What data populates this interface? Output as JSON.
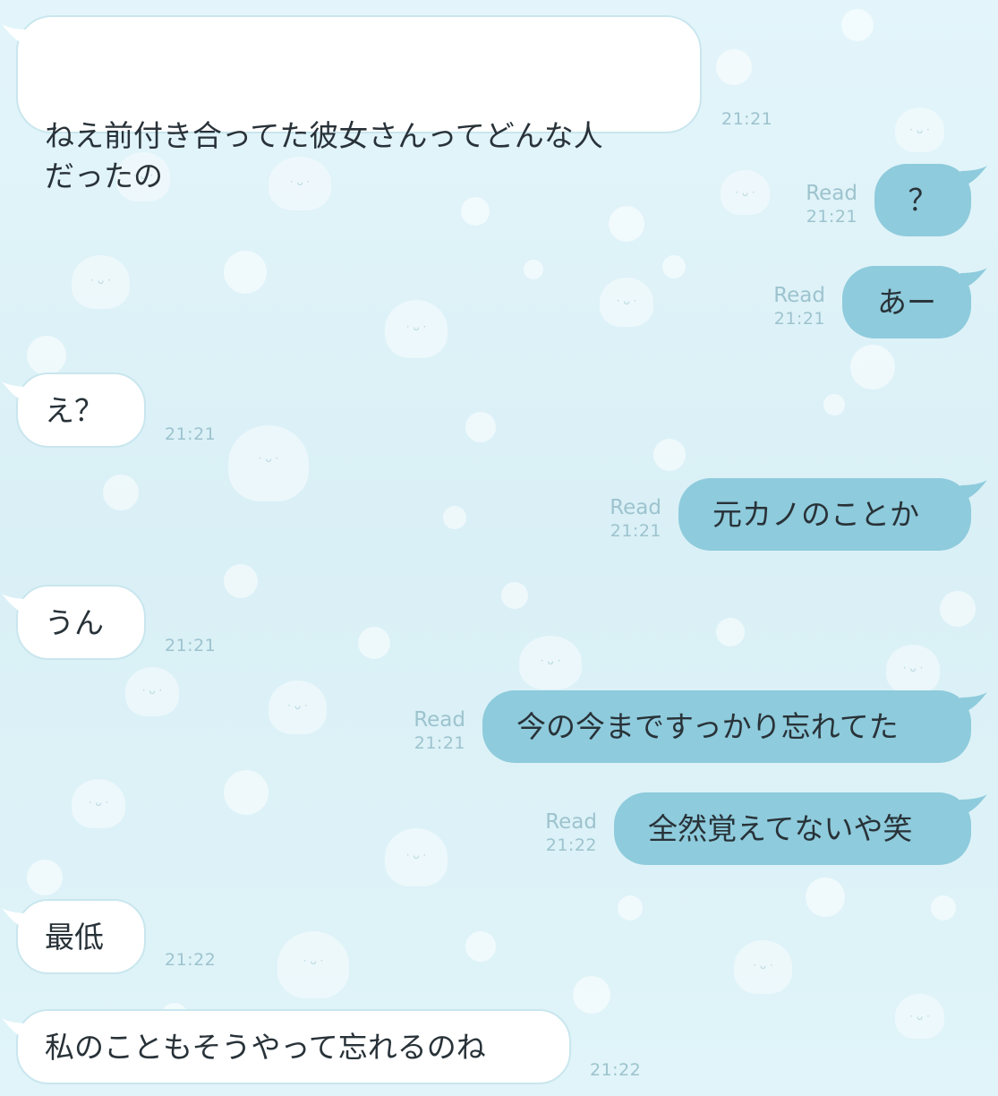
{
  "read_label": "Read",
  "messages": [
    {
      "side": "in",
      "text": "ねえ前付き合ってた彼女さんってどんな人\nだったの",
      "time": "21:21"
    },
    {
      "side": "out",
      "text": "？",
      "time": "21:21"
    },
    {
      "side": "out",
      "text": "あー",
      "time": "21:21"
    },
    {
      "side": "in",
      "text": "え？",
      "time": "21:21"
    },
    {
      "side": "out",
      "text": "元カノのことか",
      "time": "21:21"
    },
    {
      "side": "in",
      "text": "うん",
      "time": "21:21"
    },
    {
      "side": "out",
      "text": "今の今まですっかり忘れてた",
      "time": "21:21"
    },
    {
      "side": "out",
      "text": "全然覚えてないや笑",
      "time": "21:22"
    },
    {
      "side": "in",
      "text": "最低",
      "time": "21:22"
    },
    {
      "side": "in",
      "text": "私のこともそうやって忘れるのね",
      "time": "21:22"
    }
  ],
  "colors": {
    "background": "#dcf1f7",
    "incoming_bubble": "#ffffff",
    "outgoing_bubble": "#8ecbdc",
    "meta_text": "#9dc3ce"
  }
}
